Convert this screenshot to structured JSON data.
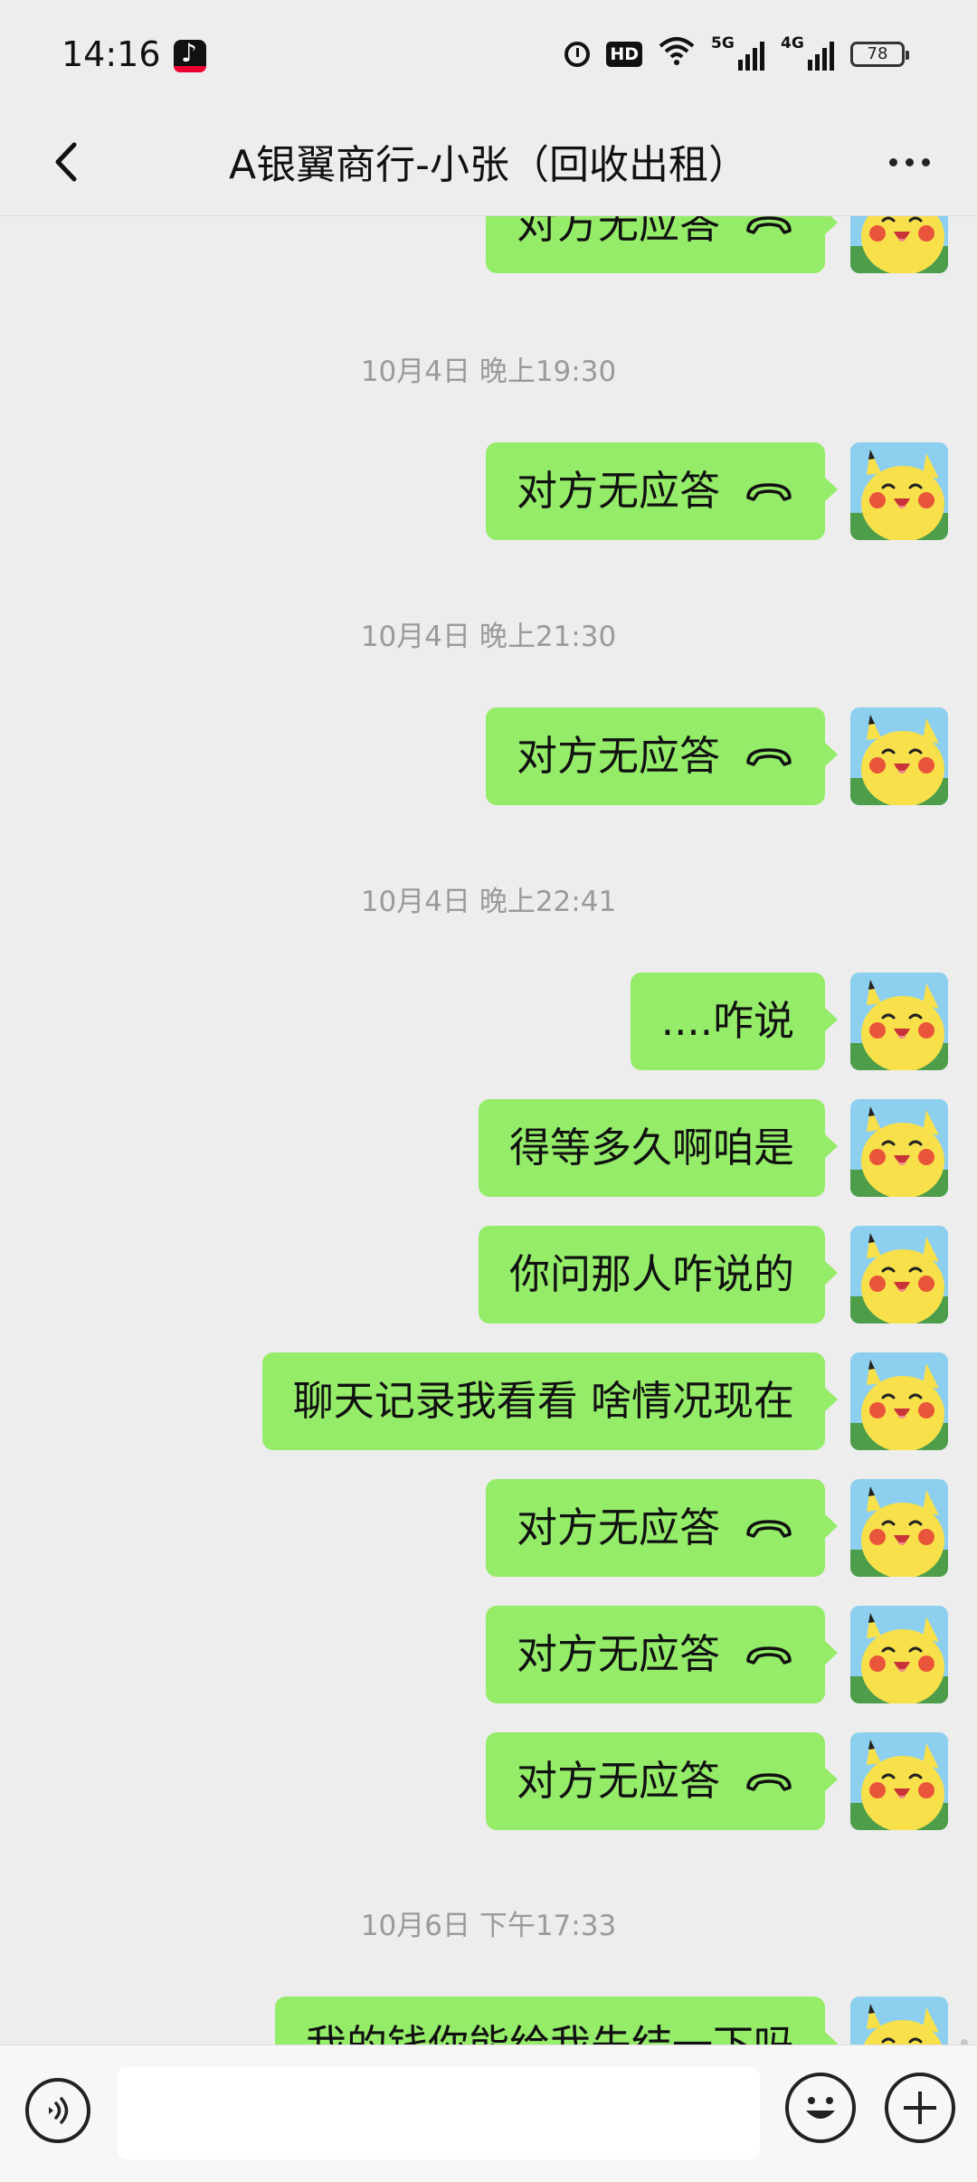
{
  "status_bar": {
    "time": "14:16",
    "app_icon": "tiktok-icon",
    "hd_label": "HD",
    "network_5g": "5G",
    "network_4g": "4G",
    "battery": "78"
  },
  "header": {
    "title": "A银翼商行-小张（回收出租）",
    "back_icon": "chevron-left-icon",
    "more_icon": "more-dots-icon"
  },
  "colors": {
    "bubble": "#95ec69",
    "background": "#ededed",
    "timestamp": "#9a9a9a"
  },
  "messages": {
    "m0": {
      "text": "对方无应答",
      "icon": "call-end-icon"
    },
    "t1": "10月4日 晚上19:30",
    "m1": {
      "text": "对方无应答",
      "icon": "call-end-icon"
    },
    "t2": "10月4日 晚上21:30",
    "m2": {
      "text": "对方无应答",
      "icon": "call-end-icon"
    },
    "t3": "10月4日 晚上22:41",
    "m3": {
      "text": "....咋说"
    },
    "m4": {
      "text": "得等多久啊咱是"
    },
    "m5": {
      "text": "你问那人咋说的"
    },
    "m6": {
      "text": "聊天记录我看看 啥情况现在"
    },
    "m7": {
      "text": "对方无应答",
      "icon": "call-end-icon"
    },
    "m8": {
      "text": "对方无应答",
      "icon": "call-end-icon"
    },
    "m9": {
      "text": "对方无应答",
      "icon": "call-end-icon"
    },
    "t4": "10月6日 下午17:33",
    "m10": {
      "text": "我的钱你能给我先结一下吗"
    }
  },
  "input_bar": {
    "voice_icon": "voice-icon",
    "emoji_icon": "emoji-icon",
    "plus_icon": "plus-icon",
    "input_value": ""
  }
}
